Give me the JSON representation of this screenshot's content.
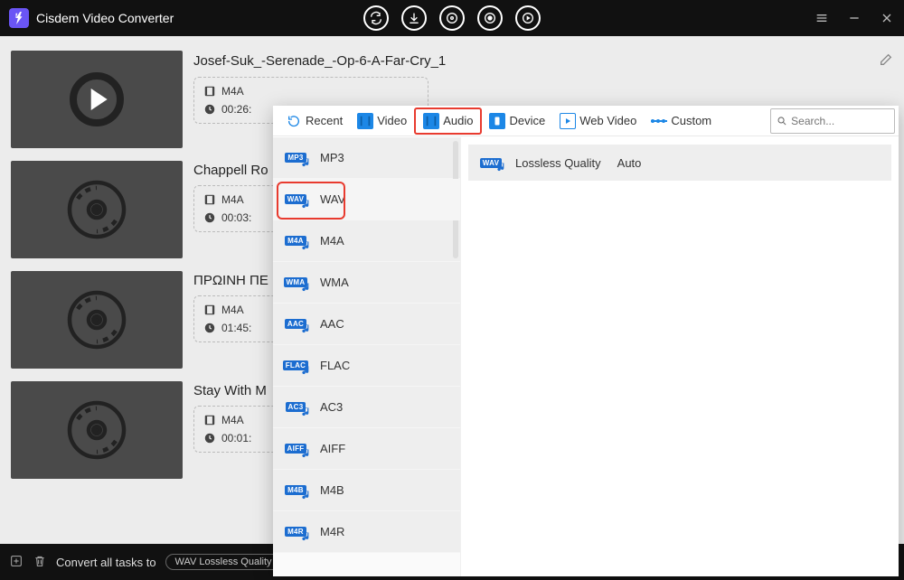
{
  "app_title": "Cisdem Video Converter",
  "items": [
    {
      "title": "Josef-Suk_-Serenade_-Op-6-A-Far-Cry_1",
      "format": "M4A",
      "duration": "00:26:",
      "thumb": "play"
    },
    {
      "title": "Chappell Ro",
      "format": "M4A",
      "duration": "00:03:",
      "thumb": "disc"
    },
    {
      "title": "ΠΡΩΙΝΗ ΠΕ",
      "format": "M4A",
      "duration": "01:45:",
      "thumb": "disc"
    },
    {
      "title": "Stay With M",
      "format": "M4A",
      "duration": "00:01:",
      "thumb": "disc"
    }
  ],
  "footer": {
    "label": "Convert all tasks to",
    "choice": "WAV Lossless Quality"
  },
  "dropdown": {
    "tabs": {
      "recent": "Recent",
      "video": "Video",
      "audio": "Audio",
      "device": "Device",
      "webvideo": "Web Video",
      "custom": "Custom"
    },
    "search_placeholder": "Search...",
    "formats": [
      "MP3",
      "WAV",
      "M4A",
      "WMA",
      "AAC",
      "FLAC",
      "AC3",
      "AIFF",
      "M4B",
      "M4R"
    ],
    "quality_label": "Lossless Quality",
    "quality_auto": "Auto"
  }
}
